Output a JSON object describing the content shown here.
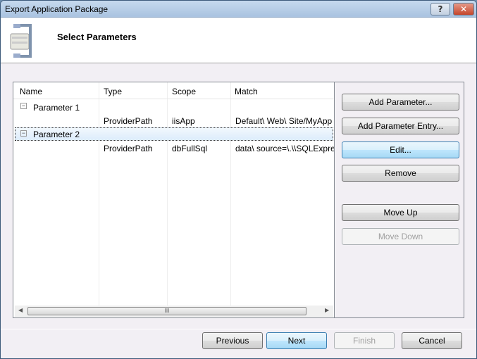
{
  "window": {
    "title": "Export Application Package",
    "help_label": "?",
    "close_label": "✕"
  },
  "header": {
    "title": "Select Parameters",
    "icon": "package-clamp-icon"
  },
  "list": {
    "columns": [
      "Name",
      "Type",
      "Scope",
      "Match"
    ],
    "rows": [
      {
        "name": "Parameter 1",
        "type": "",
        "scope": "",
        "match": "",
        "expander": "⊟"
      },
      {
        "name": "",
        "type": "ProviderPath",
        "scope": "iisApp",
        "match": "Default\\ Web\\ Site/MyApp"
      },
      {
        "name": "Parameter 2",
        "type": "",
        "scope": "",
        "match": "",
        "expander": "⊟"
      },
      {
        "name": "",
        "type": "ProviderPath",
        "scope": "dbFullSql",
        "match": "data\\ source=\\.\\\\SQLExpre"
      }
    ],
    "scroll_grip": "III"
  },
  "side_buttons": {
    "add_parameter": "Add Parameter...",
    "add_entry": "Add Parameter Entry...",
    "edit": "Edit...",
    "remove": "Remove",
    "move_up": "Move Up",
    "move_down": "Move Down"
  },
  "footer": {
    "previous": "Previous",
    "next": "Next",
    "finish": "Finish",
    "cancel": "Cancel"
  }
}
